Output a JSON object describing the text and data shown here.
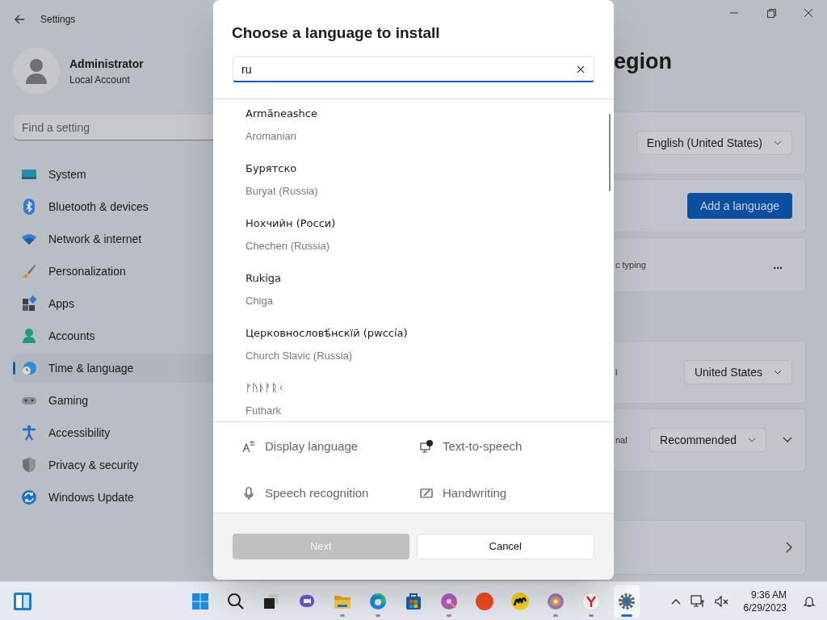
{
  "settings": {
    "title": "Settings",
    "user": {
      "name": "Administrator",
      "account": "Local Account"
    },
    "search": {
      "placeholder": "Find a setting"
    },
    "nav": [
      {
        "label": "System",
        "selected": false
      },
      {
        "label": "Bluetooth & devices",
        "selected": false
      },
      {
        "label": "Network & internet",
        "selected": false
      },
      {
        "label": "Personalization",
        "selected": false
      },
      {
        "label": "Apps",
        "selected": false
      },
      {
        "label": "Accounts",
        "selected": false
      },
      {
        "label": "Time & language",
        "selected": true
      },
      {
        "label": "Gaming",
        "selected": false
      },
      {
        "label": "Accessibility",
        "selected": false
      },
      {
        "label": "Privacy & security",
        "selected": false
      },
      {
        "label": "Windows Update",
        "selected": false
      }
    ],
    "page_title": "egion",
    "card_groups": [
      [
        {
          "kind": "dropdown",
          "value": "English (United States)"
        },
        {
          "kind": "button",
          "label": "Add a language"
        },
        {
          "kind": "more",
          "text": "c typing",
          "more": "..."
        }
      ],
      [
        {
          "kind": "dropdown",
          "text": "l",
          "value": "United States"
        },
        {
          "kind": "dropdown_expand",
          "text": "nal",
          "value": "Recommended"
        }
      ],
      [
        {
          "kind": "link"
        }
      ]
    ]
  },
  "dialog": {
    "title": "Choose a language to install",
    "search": {
      "value": "ru"
    },
    "languages": [
      {
        "native": "Armãneashce",
        "english": "Aromanian"
      },
      {
        "native": "Бурятско",
        "english": "Buryat (Russia)"
      },
      {
        "native": "Нохчийн (Росси)",
        "english": "Chechen (Russia)"
      },
      {
        "native": "Rukiga",
        "english": "Chiga"
      },
      {
        "native": "Церковнословѣ́нскїй (рwссі́а)",
        "english": "Church Slavic (Russia)"
      },
      {
        "native": "ᚠᚢᚦᚨᚱᚲ",
        "english": "Futhark"
      }
    ],
    "features": [
      {
        "label": "Display language",
        "kind": "display"
      },
      {
        "label": "Text-to-speech",
        "kind": "tts"
      },
      {
        "label": "Speech recognition",
        "kind": "speech"
      },
      {
        "label": "Handwriting",
        "kind": "handwriting"
      }
    ],
    "buttons": [
      {
        "label": "Next",
        "disabled": true
      },
      {
        "label": "Cancel",
        "disabled": false
      }
    ]
  },
  "taskbar": {
    "apps": [
      {
        "kind": "start",
        "active": false
      },
      {
        "kind": "search",
        "active": false
      },
      {
        "kind": "taskview",
        "active": false
      },
      {
        "kind": "chat",
        "active": false
      },
      {
        "kind": "folder",
        "active": true
      },
      {
        "kind": "edge",
        "active": true
      },
      {
        "kind": "store",
        "active": false
      },
      {
        "kind": "disc",
        "active": true
      },
      {
        "kind": "red",
        "active": false
      },
      {
        "kind": "yellow",
        "active": false
      },
      {
        "kind": "dvd",
        "active": true
      },
      {
        "kind": "redlight",
        "active": true
      },
      {
        "kind": "gear",
        "active": true
      }
    ],
    "time": "9:36 AM",
    "date": "6/29/2023"
  }
}
